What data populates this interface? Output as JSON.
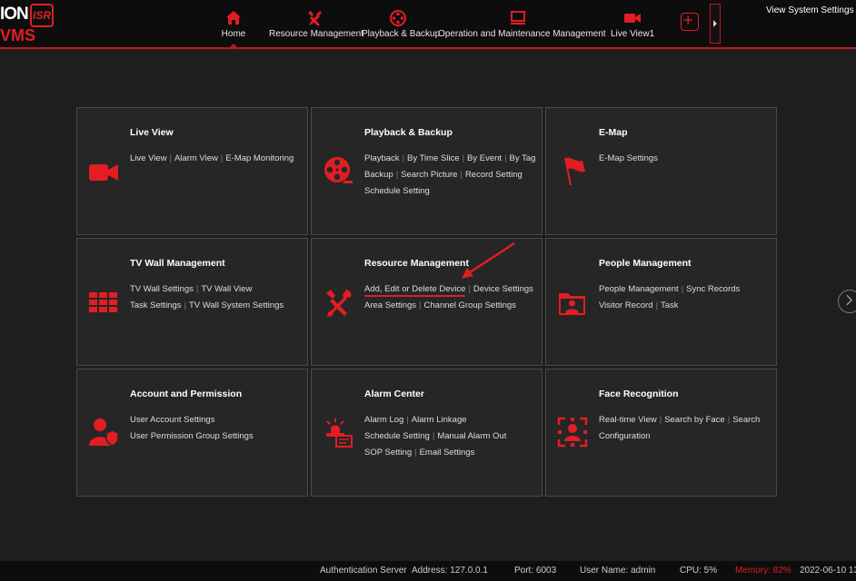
{
  "brand": {
    "logo_text": "ION",
    "logo_badge": "ISR",
    "product": "VMS"
  },
  "nav": {
    "tabs": [
      {
        "label": "Home",
        "icon": "home-icon",
        "active": true
      },
      {
        "label": "Resource Management",
        "icon": "tools-icon"
      },
      {
        "label": "Playback & Backup",
        "icon": "film-reel-icon"
      },
      {
        "label": "Operation and Maintenance Management",
        "icon": "monitor-icon"
      },
      {
        "label": "Live View1",
        "icon": "video-camera-icon"
      }
    ]
  },
  "top_links": {
    "text": "View System Settings H"
  },
  "cards": [
    {
      "title": "Live View",
      "icon": "video-camera-icon",
      "rows": [
        [
          "Live View",
          "Alarm View",
          "E-Map Monitoring"
        ]
      ]
    },
    {
      "title": "Playback & Backup",
      "icon": "film-reel-icon",
      "rows": [
        [
          "Playback",
          "By Time Slice",
          "By Event",
          "By Tag"
        ],
        [
          "Backup",
          "Search Picture",
          "Record Setting"
        ],
        [
          "Schedule Setting"
        ]
      ]
    },
    {
      "title": "E-Map",
      "icon": "map-flag-icon",
      "rows": [
        [
          "E-Map Settings"
        ]
      ]
    },
    {
      "title": "TV Wall Management",
      "icon": "tv-wall-icon",
      "rows": [
        [
          "TV Wall Settings",
          "TV Wall View"
        ],
        [
          "Task Settings",
          "TV Wall System Settings"
        ]
      ]
    },
    {
      "title": "Resource Management",
      "icon": "tools-icon",
      "rows": [
        [
          "Add, Edit or Delete Device",
          "Device Settings"
        ],
        [
          "Area Settings",
          "Channel Group Settings"
        ]
      ]
    },
    {
      "title": "People Management",
      "icon": "people-folder-icon",
      "rows": [
        [
          "People Management",
          "Sync Records"
        ],
        [
          "Visitor Record",
          "Task"
        ]
      ]
    },
    {
      "title": "Account and Permission",
      "icon": "user-shield-icon",
      "rows": [
        [
          "User Account Settings"
        ],
        [
          "User Permission Group Settings"
        ]
      ]
    },
    {
      "title": "Alarm Center",
      "icon": "alarm-icon",
      "rows": [
        [
          "Alarm Log",
          "Alarm Linkage"
        ],
        [
          "Schedule Setting",
          "Manual Alarm Out"
        ],
        [
          "SOP Setting",
          "Email Settings"
        ]
      ]
    },
    {
      "title": "Face Recognition",
      "icon": "face-scan-icon",
      "rows": [
        [
          "Real-time View",
          "Search by Face",
          "Search"
        ],
        [
          "Configuration"
        ]
      ]
    }
  ],
  "status": {
    "auth_server": "Authentication Server",
    "address": "Address: 127.0.0.1",
    "port": "Port: 6003",
    "user": "User Name: admin",
    "cpu": "CPU: 5%",
    "memory": "Memory: 82%",
    "datetime": "2022-06-10 13"
  },
  "colors": {
    "accent": "#e21d24",
    "background": "#1e1e1e",
    "card": "#262626",
    "topbar": "#0d0d0d"
  }
}
